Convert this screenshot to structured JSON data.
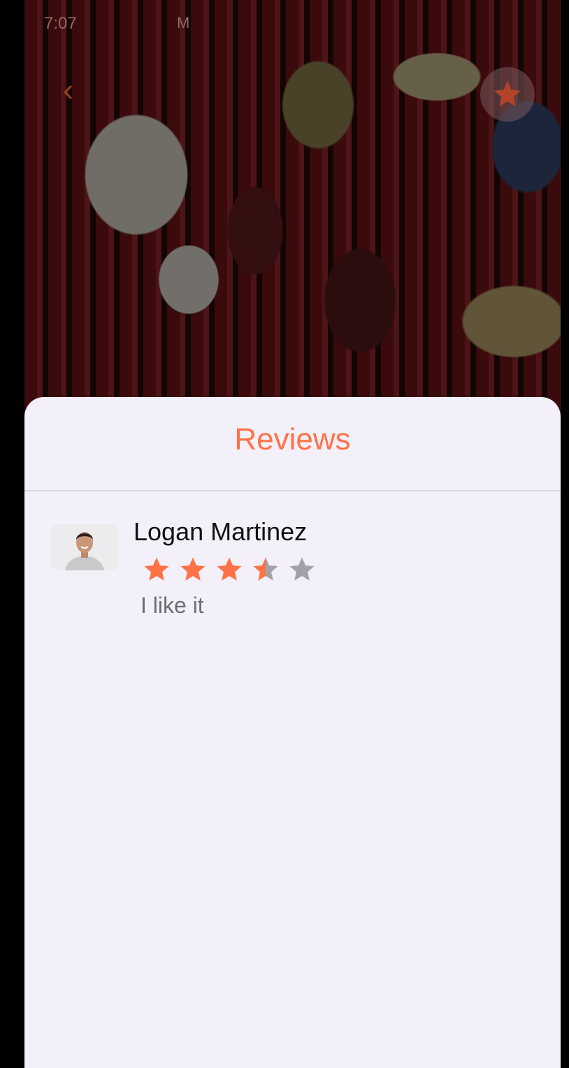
{
  "status_bar": {
    "time": "7:07",
    "mail_icon": "gmail-icon"
  },
  "top_bar": {
    "back_icon": "chevron-left-icon",
    "favorite_icon": "star-icon"
  },
  "reviews_sheet": {
    "title": "Reviews",
    "colors": {
      "accent": "#ff7246",
      "star_empty": "#a3a1a8",
      "background": "#f4f0fa"
    },
    "reviews": [
      {
        "reviewer_name": "Logan Martinez",
        "rating": 3.5,
        "rating_max": 5,
        "text": "I like it"
      }
    ]
  }
}
